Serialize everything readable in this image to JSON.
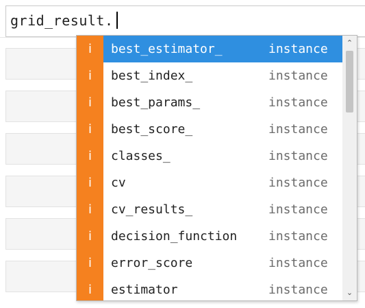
{
  "editor": {
    "code": "grid_result."
  },
  "completion": {
    "accent_color": "#f5811f",
    "selected_color": "#2f8fe0",
    "kind_icon": "i",
    "selected_index": 0,
    "items": [
      {
        "name": "best_estimator_",
        "type": "instance"
      },
      {
        "name": "best_index_",
        "type": "instance"
      },
      {
        "name": "best_params_",
        "type": "instance"
      },
      {
        "name": "best_score_",
        "type": "instance"
      },
      {
        "name": "classes_",
        "type": "instance"
      },
      {
        "name": "cv",
        "type": "instance"
      },
      {
        "name": "cv_results_",
        "type": "instance"
      },
      {
        "name": "decision_function",
        "type": "instance"
      },
      {
        "name": "error_score",
        "type": "instance"
      },
      {
        "name": "estimator",
        "type": "instance"
      }
    ],
    "scroll_up_icon": "chevron-up-icon",
    "scroll_down_icon": "chevron-down-icon"
  }
}
